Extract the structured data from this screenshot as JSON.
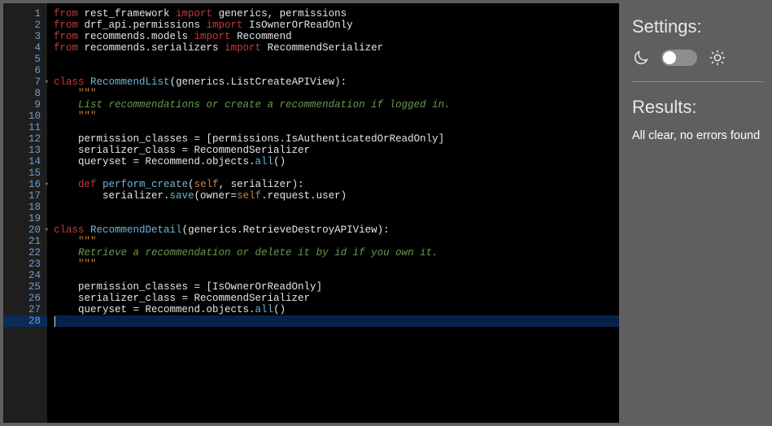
{
  "settings": {
    "title": "Settings:",
    "theme_dark_icon": "moon-icon",
    "theme_light_icon": "sun-icon"
  },
  "results": {
    "title": "Results:",
    "message": "All clear, no errors found"
  },
  "code": {
    "lines": [
      {
        "n": 1,
        "seg": [
          [
            "kw-from",
            "from"
          ],
          [
            "name",
            " rest_framework "
          ],
          [
            "kw-import",
            "import"
          ],
          [
            "name",
            " generics, permissions"
          ]
        ]
      },
      {
        "n": 2,
        "seg": [
          [
            "kw-from",
            "from"
          ],
          [
            "name",
            " drf_api.permissions "
          ],
          [
            "kw-import",
            "import"
          ],
          [
            "name",
            " IsOwnerOrReadOnly"
          ]
        ]
      },
      {
        "n": 3,
        "seg": [
          [
            "kw-from",
            "from"
          ],
          [
            "name",
            " recommends.models "
          ],
          [
            "kw-import",
            "import"
          ],
          [
            "name",
            " Recommend"
          ]
        ]
      },
      {
        "n": 4,
        "seg": [
          [
            "kw-from",
            "from"
          ],
          [
            "name",
            " recommends.serializers "
          ],
          [
            "kw-import",
            "import"
          ],
          [
            "name",
            " RecommendSerializer"
          ]
        ]
      },
      {
        "n": 5,
        "seg": []
      },
      {
        "n": 6,
        "seg": []
      },
      {
        "n": 7,
        "fold": true,
        "seg": [
          [
            "kw-class",
            "class"
          ],
          [
            "name",
            " "
          ],
          [
            "func",
            "RecommendList"
          ],
          [
            "name",
            "(generics.Li​stCreateAPIView):"
          ]
        ]
      },
      {
        "n": 8,
        "seg": [
          [
            "name",
            "    "
          ],
          [
            "docq",
            "\"\"\""
          ]
        ]
      },
      {
        "n": 9,
        "seg": [
          [
            "name",
            "    "
          ],
          [
            "docstr",
            "List recommendations or create a recommendation if logged in."
          ]
        ]
      },
      {
        "n": 10,
        "seg": [
          [
            "name",
            "    "
          ],
          [
            "docq",
            "\"\"\""
          ]
        ]
      },
      {
        "n": 11,
        "seg": []
      },
      {
        "n": 12,
        "seg": [
          [
            "name",
            "    permission_classes = [permissions.IsAuthenticatedOrReadOnly]"
          ]
        ]
      },
      {
        "n": 13,
        "seg": [
          [
            "name",
            "    serializer_class = RecommendSerializer"
          ]
        ]
      },
      {
        "n": 14,
        "seg": [
          [
            "name",
            "    queryset = Recommend.objects."
          ],
          [
            "func",
            "all"
          ],
          [
            "name",
            "()"
          ]
        ]
      },
      {
        "n": 15,
        "seg": []
      },
      {
        "n": 16,
        "fold": true,
        "seg": [
          [
            "name",
            "    "
          ],
          [
            "kw-def",
            "def"
          ],
          [
            "name",
            " "
          ],
          [
            "func",
            "perform_create"
          ],
          [
            "name",
            "("
          ],
          [
            "kw-self",
            "self"
          ],
          [
            "name",
            ", serializer):"
          ]
        ]
      },
      {
        "n": 17,
        "seg": [
          [
            "name",
            "        serializer."
          ],
          [
            "func",
            "save"
          ],
          [
            "name",
            "(owner="
          ],
          [
            "kw-self",
            "self"
          ],
          [
            "name",
            ".request.user)"
          ]
        ]
      },
      {
        "n": 18,
        "seg": []
      },
      {
        "n": 19,
        "seg": []
      },
      {
        "n": 20,
        "fold": true,
        "seg": [
          [
            "kw-class",
            "class"
          ],
          [
            "name",
            " "
          ],
          [
            "func",
            "RecommendDetail"
          ],
          [
            "name",
            "(generics.RetrieveDestroyAPIView):"
          ]
        ]
      },
      {
        "n": 21,
        "seg": [
          [
            "name",
            "    "
          ],
          [
            "docq",
            "\"\"\""
          ]
        ]
      },
      {
        "n": 22,
        "seg": [
          [
            "name",
            "    "
          ],
          [
            "docstr",
            "Retrieve a recommendation or delete it by id if you own it."
          ]
        ]
      },
      {
        "n": 23,
        "seg": [
          [
            "name",
            "    "
          ],
          [
            "docq",
            "\"\"\""
          ]
        ]
      },
      {
        "n": 24,
        "seg": []
      },
      {
        "n": 25,
        "seg": [
          [
            "name",
            "    permission_classes = [IsOwnerOrReadOnly]"
          ]
        ]
      },
      {
        "n": 26,
        "seg": [
          [
            "name",
            "    serializer_class = RecommendSerializer"
          ]
        ]
      },
      {
        "n": 27,
        "seg": [
          [
            "name",
            "    queryset = Recommend.objects."
          ],
          [
            "func",
            "all"
          ],
          [
            "name",
            "()"
          ]
        ]
      },
      {
        "n": 28,
        "active": true,
        "seg": []
      }
    ]
  }
}
